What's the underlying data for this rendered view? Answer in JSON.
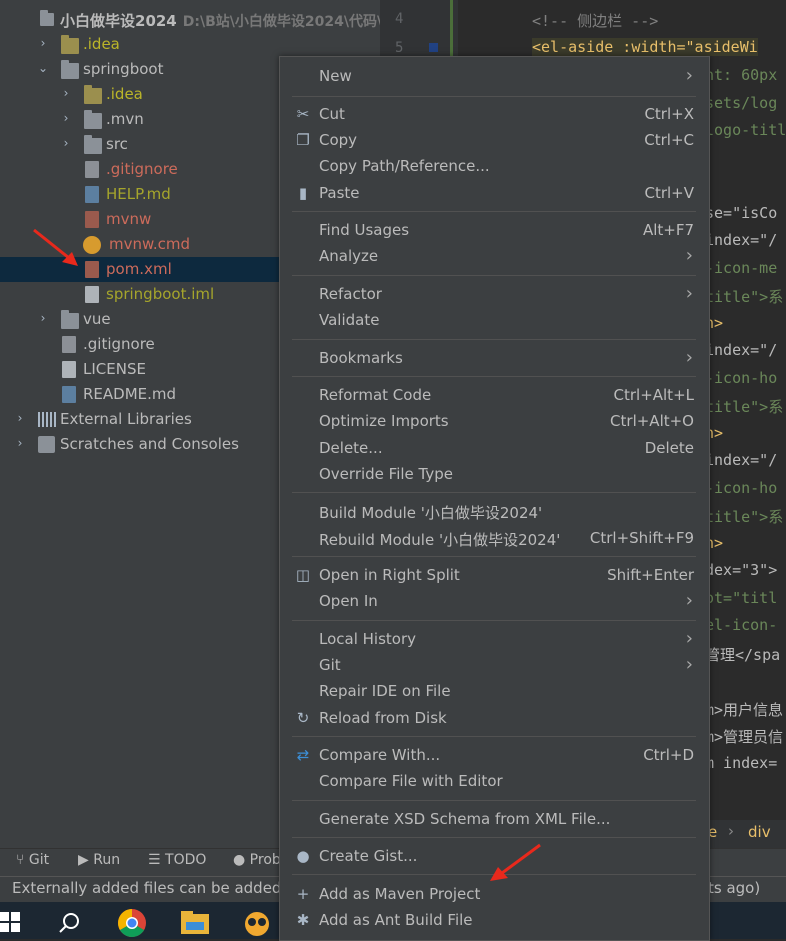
{
  "project_tree": {
    "root": {
      "name": "小白做毕设2024",
      "path": "D:\\B站\\小白做毕设2024\\代码\\"
    },
    "items": [
      {
        "label": ".idea"
      },
      {
        "label": "springboot"
      },
      {
        "label": ".idea"
      },
      {
        "label": ".mvn"
      },
      {
        "label": "src"
      },
      {
        "label": ".gitignore"
      },
      {
        "label": "HELP.md"
      },
      {
        "label": "mvnw"
      },
      {
        "label": "mvnw.cmd"
      },
      {
        "label": "pom.xml"
      },
      {
        "label": "springboot.iml"
      },
      {
        "label": "vue"
      },
      {
        "label": ".gitignore"
      },
      {
        "label": "LICENSE"
      },
      {
        "label": "README.md"
      },
      {
        "label": "External Libraries"
      },
      {
        "label": "Scratches and Consoles"
      }
    ]
  },
  "editor": {
    "line_numbers": [
      "4",
      "5"
    ],
    "code_lines": [
      "<!--     侧边栏  -->",
      "<el-aside :width=\"asideWi",
      "ht: 60px",
      "sets/log",
      "logo-titl",
      "se=\"isCo",
      "index=\"/",
      "-icon-me",
      "title\">系",
      "n>",
      "index=\"/",
      "-icon-ho",
      "title\">系",
      "n>",
      "index=\"/",
      "-icon-ho",
      "title\">系",
      "n>",
      "dex=\"3\">",
      "ot=\"titl",
      "el-icon-",
      "管理</spa",
      "m>用户信息",
      "m>管理员信",
      "m index=",
      "e",
      "div"
    ]
  },
  "context_menu": {
    "items": [
      {
        "label": "New",
        "shortcut": "",
        "submenu": true
      },
      {
        "label": "Cut",
        "shortcut": "Ctrl+X",
        "icon": "scissors-icon"
      },
      {
        "label": "Copy",
        "shortcut": "Ctrl+C",
        "icon": "copy-icon"
      },
      {
        "label": "Copy Path/Reference...",
        "shortcut": ""
      },
      {
        "label": "Paste",
        "shortcut": "Ctrl+V",
        "icon": "clipboard-icon"
      },
      {
        "label": "Find Usages",
        "shortcut": "Alt+F7"
      },
      {
        "label": "Analyze",
        "shortcut": "",
        "submenu": true
      },
      {
        "label": "Refactor",
        "shortcut": "",
        "submenu": true
      },
      {
        "label": "Validate",
        "shortcut": ""
      },
      {
        "label": "Bookmarks",
        "shortcut": "",
        "submenu": true
      },
      {
        "label": "Reformat Code",
        "shortcut": "Ctrl+Alt+L"
      },
      {
        "label": "Optimize Imports",
        "shortcut": "Ctrl+Alt+O"
      },
      {
        "label": "Delete...",
        "shortcut": "Delete"
      },
      {
        "label": "Override File Type",
        "shortcut": ""
      },
      {
        "label": "Build Module '小白做毕设2024'",
        "shortcut": ""
      },
      {
        "label": "Rebuild Module '小白做毕设2024'",
        "shortcut": "Ctrl+Shift+F9"
      },
      {
        "label": "Open in Right Split",
        "shortcut": "Shift+Enter",
        "icon": "split-icon"
      },
      {
        "label": "Open In",
        "shortcut": "",
        "submenu": true
      },
      {
        "label": "Local History",
        "shortcut": "",
        "submenu": true
      },
      {
        "label": "Git",
        "shortcut": "",
        "submenu": true
      },
      {
        "label": "Repair IDE on File",
        "shortcut": ""
      },
      {
        "label": "Reload from Disk",
        "shortcut": "",
        "icon": "reload-icon"
      },
      {
        "label": "Compare With...",
        "shortcut": "Ctrl+D",
        "icon": "compare-icon"
      },
      {
        "label": "Compare File with Editor",
        "shortcut": ""
      },
      {
        "label": "Generate XSD Schema from XML File...",
        "shortcut": ""
      },
      {
        "label": "Create Gist...",
        "shortcut": "",
        "icon": "github-icon"
      },
      {
        "label": "Add as Maven Project",
        "shortcut": "",
        "icon": "plus-icon"
      },
      {
        "label": "Add as Ant Build File",
        "shortcut": "",
        "icon": "ant-icon"
      }
    ]
  },
  "tool_window_bar": {
    "git": "Git",
    "run": "Run",
    "todo": "TODO",
    "problems": "Prob"
  },
  "status_bar": {
    "left_text": "Externally added files can be added t",
    "right_text": "ts ago)"
  },
  "colors": {
    "panel": "#3c3f41",
    "editor": "#2b2b2b",
    "selection": "#0d293e",
    "annotation_arrow": "#e8291c"
  }
}
